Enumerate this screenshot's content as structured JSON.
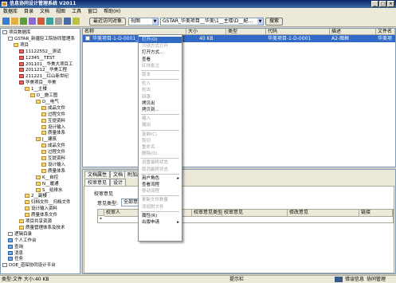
{
  "window": {
    "title": "信息协同设计管理系统 V2011",
    "btn_min": "_",
    "btn_max": "□",
    "btn_close": "×"
  },
  "menu": [
    "数据库",
    "目录",
    "文档",
    "视图",
    "工具",
    "窗口",
    "帮助(H)"
  ],
  "toolbar": {
    "recent_button": "最近访问对象",
    "view_combo": "视图",
    "path_combo": "GSTAR_华美项目__华美\\1__主楼\\D__配…",
    "search_button": "搜索"
  },
  "tree": [
    {
      "label": "项目数据库",
      "icon": "d",
      "indent": 0
    },
    {
      "label": "GSTAR_新疆轻工院协同管理系",
      "icon": "d",
      "indent": 1
    },
    {
      "label": "项目",
      "icon": "f",
      "indent": 2
    },
    {
      "label": "11122552__测试",
      "icon": "r",
      "indent": 3
    },
    {
      "label": "12345__TEST",
      "icon": "r",
      "indent": 3
    },
    {
      "label": "201101__华美大项目工",
      "icon": "r",
      "indent": 3
    },
    {
      "label": "2011212__华美工程",
      "icon": "r",
      "indent": 3
    },
    {
      "label": "211221__红山新世纪",
      "icon": "r",
      "indent": 3
    },
    {
      "label": "华美项目__华美",
      "icon": "r",
      "indent": 3
    },
    {
      "label": "1__主楼",
      "icon": "f",
      "indent": 4
    },
    {
      "label": "D__施工图",
      "icon": "f",
      "indent": 5
    },
    {
      "label": "D__电气",
      "icon": "f",
      "indent": 6
    },
    {
      "label": "成品文件",
      "icon": "f",
      "indent": 7
    },
    {
      "label": "过程文件",
      "icon": "f",
      "indent": 7
    },
    {
      "label": "互提资料",
      "icon": "f",
      "indent": 7
    },
    {
      "label": "设计输入",
      "icon": "f",
      "indent": 7
    },
    {
      "label": "质量体系",
      "icon": "f",
      "indent": 7
    },
    {
      "label": "J__建筑",
      "icon": "f",
      "indent": 6
    },
    {
      "label": "成品文件",
      "icon": "f",
      "indent": 7
    },
    {
      "label": "过程文件",
      "icon": "f",
      "indent": 7
    },
    {
      "label": "互提资料",
      "icon": "f",
      "indent": 7
    },
    {
      "label": "设计输入",
      "icon": "f",
      "indent": 7
    },
    {
      "label": "质量体系",
      "icon": "f",
      "indent": 7
    },
    {
      "label": "K__自控",
      "icon": "f",
      "indent": 6
    },
    {
      "label": "N__暖通",
      "icon": "f",
      "indent": 6
    },
    {
      "label": "S__给排水",
      "icon": "f",
      "indent": 6
    },
    {
      "label": "2__副楼",
      "icon": "f",
      "indent": 4
    },
    {
      "label": "归档文件__归档文件",
      "icon": "f",
      "indent": 4
    },
    {
      "label": "设计输入资料",
      "icon": "f",
      "indent": 4
    },
    {
      "label": "质量体系文件",
      "icon": "f",
      "indent": 4
    },
    {
      "label": "项目共享资源",
      "icon": "f",
      "indent": 3
    },
    {
      "label": "质量管理体系及技术",
      "icon": "f",
      "indent": 3
    },
    {
      "label": "逻辑目录",
      "icon": "d",
      "indent": 1
    },
    {
      "label": "个人工作台",
      "icon": "u",
      "indent": 1
    },
    {
      "label": "查询",
      "icon": "u",
      "indent": 1
    },
    {
      "label": "消息",
      "icon": "u",
      "indent": 1
    },
    {
      "label": "任务",
      "icon": "u",
      "indent": 1
    },
    {
      "label": "DOE_道琛协同设计平台",
      "icon": "d",
      "indent": 0
    }
  ],
  "grid": {
    "headers": [
      "名称",
      "大小",
      "类型",
      "代码",
      "描述",
      "文件名"
    ],
    "row": [
      "华美项目-1-D-0001_A2-图框",
      "40 KB",
      "",
      "华美项目-1-D-0001",
      "A2-图框",
      "华美项"
    ]
  },
  "bottom": {
    "tabs1": [
      "文档属性",
      "文档",
      "附加属性",
      "版本"
    ],
    "tabs2": [
      "校审意见",
      "设计"
    ],
    "section_label": "校审意见",
    "opinion_type_label": "意见类型:",
    "opinion_type_value": "全部意见",
    "columns": [
      "校审人",
      "校审意见类型",
      "校审意见",
      "修改意见",
      "链接"
    ],
    "row_marker": "*"
  },
  "context_menu": [
    {
      "label": "打开(O)",
      "state": "hi"
    },
    {
      "label": "只读方式打开",
      "state": "dis"
    },
    {
      "label": "打开方式...",
      "state": ""
    },
    {
      "label": "查看",
      "state": ""
    },
    {
      "label": "红线批注",
      "state": "dis"
    },
    {
      "sep": true
    },
    {
      "label": "版本",
      "state": "dis"
    },
    {
      "sep": true
    },
    {
      "label": "检入",
      "state": "dis"
    },
    {
      "label": "检出",
      "state": "dis"
    },
    {
      "label": "回滚",
      "state": "dis"
    },
    {
      "label": "拷贝出",
      "state": ""
    },
    {
      "label": "拷贝到...",
      "state": ""
    },
    {
      "sep": true
    },
    {
      "label": "编入",
      "state": "dis"
    },
    {
      "label": "输出",
      "state": "dis"
    },
    {
      "sep": true
    },
    {
      "label": "复制(C)",
      "state": "dis"
    },
    {
      "label": "剪切",
      "state": "dis"
    },
    {
      "label": "重命名",
      "state": "dis"
    },
    {
      "label": "删除(D)",
      "state": "dis"
    },
    {
      "sep": true
    },
    {
      "label": "设置最终状态",
      "state": "dis"
    },
    {
      "label": "取消最终状态",
      "state": "dis"
    },
    {
      "sep": true
    },
    {
      "label": "用户角色",
      "state": "",
      "sub": "▸"
    },
    {
      "label": "查看流程",
      "state": ""
    },
    {
      "label": "移动流程",
      "state": "dis"
    },
    {
      "sep": true
    },
    {
      "label": "更新文件数量",
      "state": "dis"
    },
    {
      "label": "添加附文件",
      "state": "dis"
    },
    {
      "sep": true
    },
    {
      "label": "属性(R)",
      "state": ""
    },
    {
      "label": "出版申请",
      "state": "",
      "sub": "▸"
    }
  ],
  "status": {
    "left": "类型:文件 大小:40 KB",
    "center": "提示栏",
    "right_tab1": "",
    "right_tab2": "错误信息",
    "right_tab3": "协同管理"
  }
}
